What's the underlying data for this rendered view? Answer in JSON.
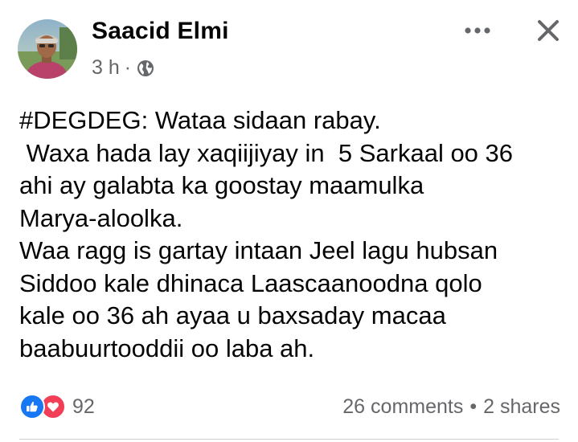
{
  "post": {
    "author_name": "Saacid Elmi",
    "time_ago": "3 h",
    "meta_separator": "·",
    "privacy_icon": "globe-icon",
    "more_icon": "more-dots-icon",
    "close_icon": "close-icon",
    "text_lines": [
      "#DEGDEG: Wataa sidaan rabay.",
      " Waxa hada lay xaqiijiyay in  5 Sarkaal oo 36",
      "ahi ay galabta ka goostay maamulka",
      "Marya-aloolka.",
      "Waa ragg is gartay intaan Jeel lagu hubsan",
      "Siddoo kale dhinaca Laascaanoodna qolo",
      "kale oo 36 ah ayaa u baxsaday macaa",
      "baabuurtooddii oo laba ah."
    ]
  },
  "engagement": {
    "reaction_icons": [
      "like-icon",
      "love-icon"
    ],
    "reaction_count": "92",
    "comments": "26 comments",
    "separator": "•",
    "shares": "2 shares"
  },
  "colors": {
    "text_primary": "#050505",
    "text_secondary": "#65676b",
    "like_blue": "#1877f2",
    "love_red": "#f33e58",
    "divider": "#ced0d4"
  }
}
